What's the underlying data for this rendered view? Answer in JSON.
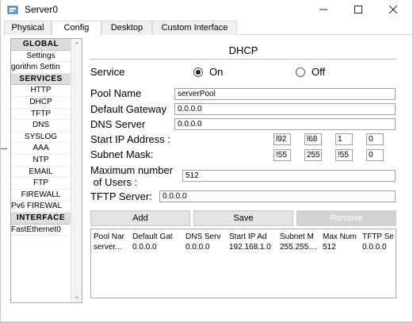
{
  "window": {
    "title": "Server0",
    "icon": "network-device-icon",
    "controls": {
      "minimize": "minimize-icon",
      "maximize": "maximize-icon",
      "close": "close-icon"
    }
  },
  "tabs": [
    {
      "label": "Physical",
      "active": false
    },
    {
      "label": "Config",
      "active": true
    },
    {
      "label": "Desktop",
      "active": false
    },
    {
      "label": "Custom Interface",
      "active": false
    }
  ],
  "sidebar": {
    "items": [
      {
        "label": "GLOBAL",
        "type": "header"
      },
      {
        "label": "Settings",
        "type": "item"
      },
      {
        "label": "gorithm Settin",
        "type": "item"
      },
      {
        "label": "SERVICES",
        "type": "header"
      },
      {
        "label": "HTTP",
        "type": "item"
      },
      {
        "label": "DHCP",
        "type": "item"
      },
      {
        "label": "TFTP",
        "type": "item"
      },
      {
        "label": "DNS",
        "type": "item"
      },
      {
        "label": "SYSLOG",
        "type": "item"
      },
      {
        "label": "AAA",
        "type": "item"
      },
      {
        "label": "NTP",
        "type": "item"
      },
      {
        "label": "EMAIL",
        "type": "item"
      },
      {
        "label": "FTP",
        "type": "item"
      },
      {
        "label": "FIREWALL",
        "type": "item"
      },
      {
        "label": "Pv6 FIREWAL",
        "type": "item"
      },
      {
        "label": "INTERFACE",
        "type": "header"
      },
      {
        "label": "FastEthernet0",
        "type": "item"
      }
    ]
  },
  "dhcp": {
    "title": "DHCP",
    "service_label": "Service",
    "service_on": "On",
    "service_off": "Off",
    "service_state": "on",
    "pool_name_label": "Pool Name",
    "pool_name_value": "serverPool",
    "default_gateway_label": "Default Gateway",
    "default_gateway_value": "0.0.0.0",
    "dns_server_label": "DNS Server",
    "dns_server_value": "0.0.0.0",
    "start_ip_label": "Start IP Address :",
    "start_ip_octets": [
      "192",
      "168",
      "1",
      "0"
    ],
    "start_ip_shown": [
      "l92",
      "l68",
      "1",
      "0"
    ],
    "subnet_mask_label": "Subnet Mask:",
    "subnet_mask_octets": [
      "255",
      "255",
      "255",
      "0"
    ],
    "subnet_mask_shown": [
      "!55",
      "255",
      "!55",
      "0"
    ],
    "max_users_label_line1": "Maximum number",
    "max_users_label_line2": " of Users :",
    "max_users_value": "512",
    "tftp_server_label": "TFTP Server:",
    "tftp_server_value": "0.0.0.0",
    "buttons": {
      "add": "Add",
      "save": "Save",
      "remove": "Remove"
    },
    "table": {
      "headers": [
        "Pool Nar",
        "Default Gat",
        "DNS Serv",
        "Start IP Ad",
        "Subnet M",
        "Max Num",
        "TFTP Se"
      ],
      "rows": [
        [
          "server...",
          "0.0.0.0",
          "0.0.0.0",
          "192.168.1.0",
          "255.255....",
          "512",
          "0.0.0.0"
        ]
      ]
    }
  },
  "colors": {
    "sidebar_header_bg": "#dcdcdc",
    "button_bg": "#e3e3e3",
    "button_disabled_bg": "#d2d2d2",
    "border": "#a9a9a9"
  }
}
